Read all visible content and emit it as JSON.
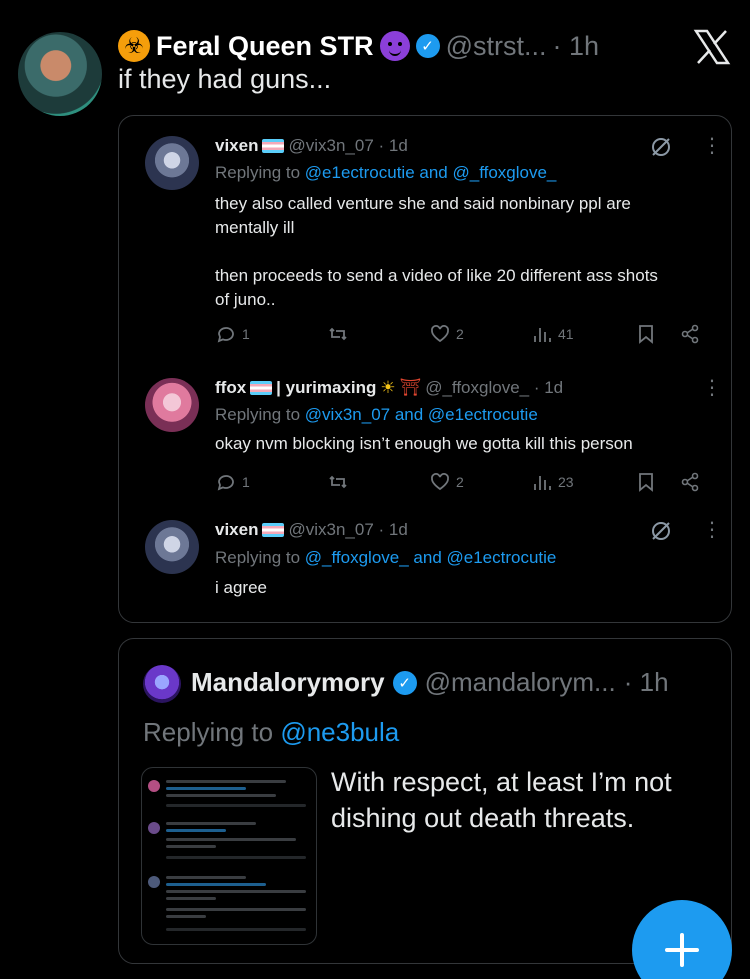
{
  "post": {
    "display_name": "Feral Queen STR",
    "handle": "@strst...",
    "time": "· 1h",
    "text": "if they had guns..."
  },
  "quoted_thread": {
    "replies": [
      {
        "name": "vixen",
        "meta": "@vix3n_07 · 1d",
        "replying_prefix": "Replying to",
        "replying_to": "@e1ectrocutie and @_ffoxglove_",
        "body_lines": [
          "they also called venture she and said nonbinary ppl are",
          "mentally ill",
          "",
          "then proceeds to send a video of like 20 different ass shots",
          "of juno.."
        ],
        "replies": "1",
        "likes": "2",
        "views": "41"
      },
      {
        "name": "ffox",
        "name_suffix": "| yurimaxing",
        "meta": "@_ffoxglove_ · 1d",
        "replying_prefix": "Replying to",
        "replying_to": "@vix3n_07 and @e1ectrocutie",
        "body_lines": [
          "okay nvm blocking isn’t enough we gotta kill this person"
        ],
        "replies": "1",
        "likes": "2",
        "views": "23"
      },
      {
        "name": "vixen",
        "meta": "@vix3n_07 · 1d",
        "replying_prefix": "Replying to",
        "replying_to": "@_ffoxglove_ and @e1ectrocutie",
        "body_lines": [
          "i agree"
        ]
      }
    ]
  },
  "reply_post": {
    "display_name": "Mandalorymory",
    "handle": "@mandalorym...",
    "time": "· 1h",
    "replying_prefix": "Replying to",
    "replying_to": "@ne3bula",
    "text_lines": [
      "With respect, at least I’m not",
      "dishing out death threats."
    ]
  },
  "colors": {
    "accent": "#1d9bf0",
    "muted": "#71767b",
    "border": "#333639",
    "background": "#000000"
  }
}
